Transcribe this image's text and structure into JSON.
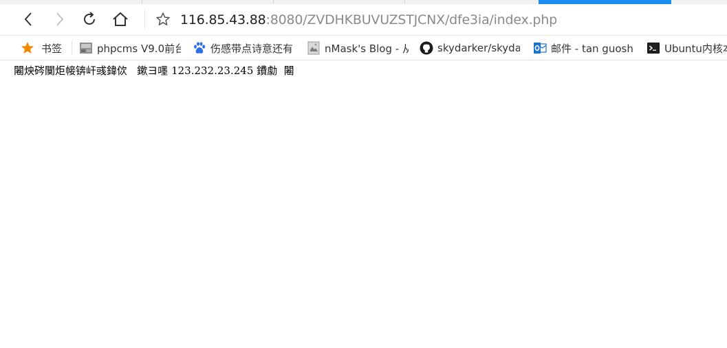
{
  "address_bar": {
    "url_host": "116.85.43.88",
    "url_rest": ":8080/ZVDHKBUVUZSTJCNX/dfe3ia/index.php"
  },
  "nav": {
    "back_icon": "back-arrow-icon",
    "forward_icon": "forward-arrow-icon",
    "reload_icon": "reload-icon",
    "home_icon": "home-icon",
    "star_icon": "bookmark-star-icon"
  },
  "bookmarks": [
    {
      "label": "书签",
      "icon": "star-icon"
    },
    {
      "label": "phpcms V9.0前台",
      "icon": "site-thumbnail-icon"
    },
    {
      "label": "伤感带点诗意还有",
      "icon": "baidu-paw-icon"
    },
    {
      "label": "nMask's Blog - 从",
      "icon": "page-thumbnail-icon"
    },
    {
      "label": "skydarker/skyda",
      "icon": "github-icon"
    },
    {
      "label": "邮件 - tan guosh",
      "icon": "outlook-icon"
    },
    {
      "label": "Ubuntu内核本",
      "icon": "terminal-icon"
    }
  ],
  "page": {
    "body_text": "闂炴硶闃炬帹锛屽彧鍏佽   鏉ヨ嚜 123.232.23.245 鐨勮  闂"
  },
  "colors": {
    "active_tab": "#1a8cf0",
    "star": "#f08a00",
    "baidu": "#2d6fe6",
    "outlook": "#1a73c8"
  }
}
